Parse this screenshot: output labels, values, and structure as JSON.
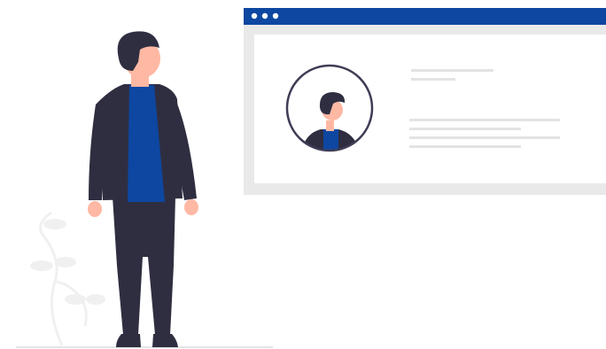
{
  "illustration": {
    "subject": "person-standing-next-to-profile-window",
    "colors": {
      "accent_blue": "#0d47a1",
      "suit_dark": "#2f2e41",
      "skin": "#ffb8a3",
      "hair": "#2f2e41",
      "window_frame": "#e6e6e6",
      "window_body": "#ffffff",
      "text_placeholder": "#e6e6e6",
      "plant": "#f0f0f0",
      "ground": "#e0e0e0"
    },
    "window": {
      "titlebar_dots": 3,
      "text_lines_top": 2,
      "text_lines_bottom": 4
    }
  }
}
